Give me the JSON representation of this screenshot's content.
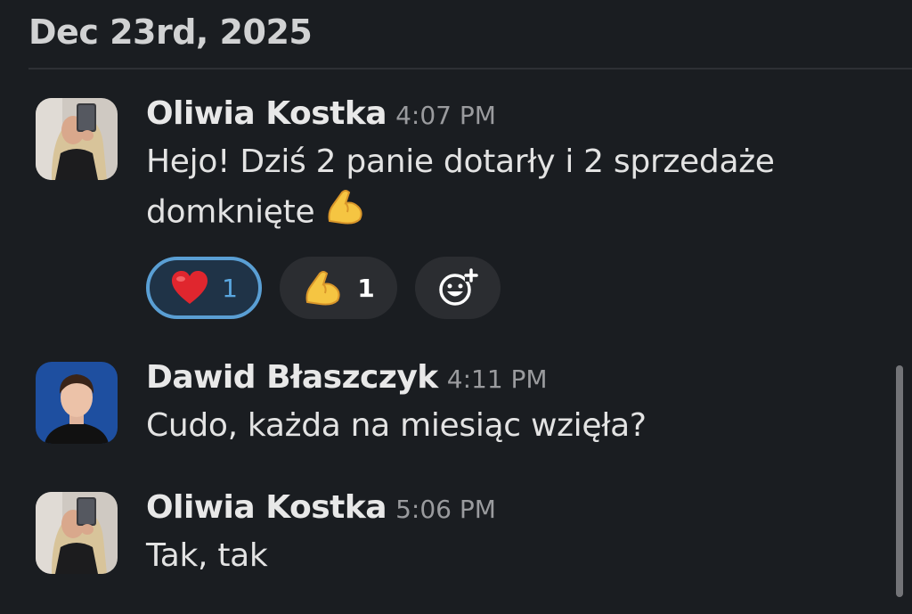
{
  "date_header": "Dec 23rd, 2025",
  "messages": [
    {
      "author": "Oliwia Kostka",
      "time": "4:07 PM",
      "text": "Hejo! Dziś 2 panie dotarły i 2 sprzedaże domknięte",
      "reactions": [
        {
          "emoji": "heart-emoji",
          "count": "1",
          "reacted_by_me": true
        },
        {
          "emoji": "flexed-biceps-emoji",
          "count": "1",
          "reacted_by_me": false
        }
      ],
      "add_reaction_icon": "add-reaction-icon"
    },
    {
      "author": "Dawid Błaszczyk",
      "time": "4:11 PM",
      "text": "Cudo, każda na miesiąc wzięła?"
    },
    {
      "author": "Oliwia Kostka",
      "time": "5:06 PM",
      "text": "Tak, tak"
    }
  ],
  "colors": {
    "background": "#1a1d21",
    "reaction_active_border": "#5a9fd4",
    "reaction_bg": "#2b2d31"
  }
}
